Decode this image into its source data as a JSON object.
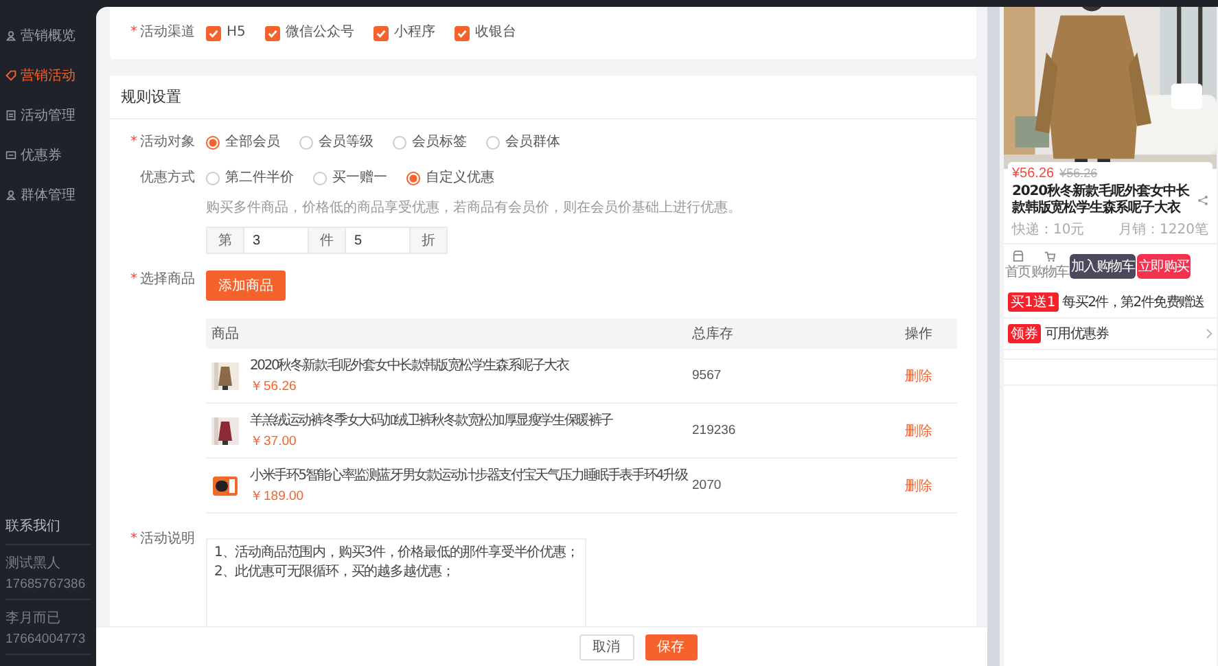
{
  "sidebar": {
    "items": [
      {
        "label": "营销概览",
        "selected": false
      },
      {
        "label": "营销活动",
        "selected": true
      },
      {
        "label": "活动管理",
        "selected": false
      },
      {
        "label": "优惠券",
        "selected": false
      },
      {
        "label": "群体管理",
        "selected": false
      }
    ],
    "contact": {
      "title": "联系我们",
      "people": [
        {
          "name": "测试黑人",
          "phone": "17685767386"
        },
        {
          "name": "李月而已",
          "phone": "17664004773"
        }
      ]
    }
  },
  "form": {
    "channels": {
      "label": "活动渠道",
      "required_mark": "*",
      "options": [
        {
          "label": "H5",
          "checked": true
        },
        {
          "label": "微信公众号",
          "checked": true
        },
        {
          "label": "小程序",
          "checked": true
        },
        {
          "label": "收银台",
          "checked": true
        }
      ]
    },
    "rules": {
      "title": "规则设置",
      "target": {
        "label": "活动对象",
        "required_mark": "*",
        "options": [
          {
            "label": "全部会员",
            "selected": true
          },
          {
            "label": "会员等级",
            "selected": false
          },
          {
            "label": "会员标签",
            "selected": false
          },
          {
            "label": "会员群体",
            "selected": false
          }
        ]
      },
      "discount": {
        "label": "优惠方式",
        "options": [
          {
            "label": "第二件半价",
            "selected": false
          },
          {
            "label": "买一赠一",
            "selected": false
          },
          {
            "label": "自定义优惠",
            "selected": true
          }
        ],
        "hint": "购买多件商品，价格低的商品享受优惠，若商品有会员价，则在会员价基础上进行优惠。",
        "addons": [
          "第",
          "件",
          "折"
        ],
        "values": [
          "3",
          "5"
        ]
      },
      "goods": {
        "label": "选择商品",
        "required_mark": "*",
        "button": "添加商品",
        "table": {
          "columns": [
            "商品",
            "总库存",
            "操作"
          ],
          "rows": [
            {
              "title": "2020秋冬新款毛呢外套女中长款韩版宽松学生森系呢子大衣",
              "price": "￥56.26",
              "stock": "9567",
              "action": "删除",
              "kind": "picture"
            },
            {
              "title": "羊羔绒运动裤冬季女大码加绒卫裤秋冬款宽松加厚显瘦学生保暖裤子",
              "price": "￥37.00",
              "stock": "219236",
              "action": "删除",
              "kind": "picture"
            },
            {
              "title": "小米手环5智能心率监测蓝牙男女款运动计步器支付宝天气压力睡眠手表手环4升级",
              "price": "￥189.00",
              "stock": "2070",
              "action": "删除",
              "kind": "picture"
            }
          ]
        }
      },
      "description": {
        "label": "活动说明",
        "required_mark": "*",
        "lines": [
          "1、活动商品范围内，购买3件，价格最低的那件享受半价优惠；",
          "2、此优惠可无限循环，买的越多越优惠；"
        ]
      }
    }
  },
  "footer": {
    "buttons": [
      {
        "label": "取消",
        "kind": "secondary"
      },
      {
        "label": "保存",
        "kind": "primary"
      }
    ]
  },
  "preview": {
    "kind": "picture",
    "price": "¥56.26",
    "old_price": "¥56.26",
    "title": "2020秋冬新款毛呢外套女中长款韩版宽松学生森系呢子大衣",
    "shipping": "快递：10元",
    "sales": "月销：1220笔",
    "nav": [
      "首页",
      "购物车"
    ],
    "actions": [
      {
        "label": "加入购物车",
        "kind": "cart"
      },
      {
        "label": "立即购买",
        "kind": "buy"
      }
    ],
    "promos": [
      {
        "badge": "买1送1",
        "text": "每买2件，第2件免费赠送",
        "chevron": false
      },
      {
        "badge": "领券",
        "text": "可用优惠券",
        "chevron": true
      }
    ]
  }
}
